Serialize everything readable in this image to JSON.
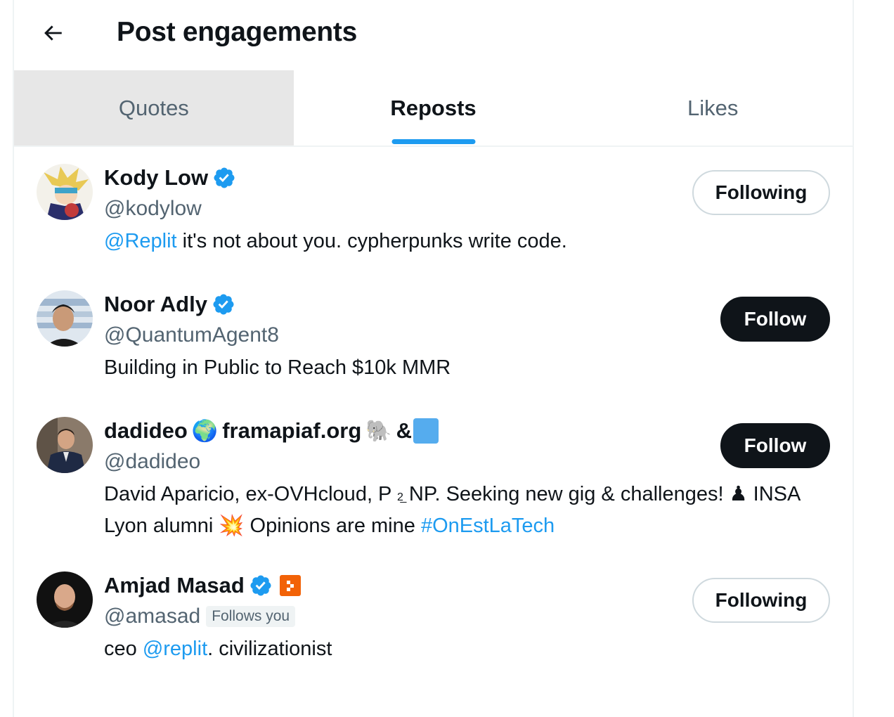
{
  "header": {
    "title": "Post engagements",
    "back_icon": "arrow-left-icon"
  },
  "tabs": [
    {
      "label": "Quotes",
      "state": "hover"
    },
    {
      "label": "Reposts",
      "state": "active"
    },
    {
      "label": "Likes",
      "state": "default"
    }
  ],
  "colors": {
    "accent": "#1d9bf0",
    "text": "#0f1419",
    "muted": "#536471",
    "border": "#cfd9de"
  },
  "users": [
    {
      "name": "Kody Low",
      "verified": true,
      "handle": "@kodylow",
      "bio_mention": "@Replit",
      "bio_text": " it's not about you. cypherpunks write code.",
      "button": "Following"
    },
    {
      "name": "Noor Adly",
      "verified": true,
      "handle": "@QuantumAgent8",
      "bio_text": "Building in Public to Reach $10k MMR",
      "button": "Follow"
    },
    {
      "name_part1": "dadideo",
      "globe_emoji": "🌍",
      "name_part2": "framapiaf.org",
      "elephant_emoji": "🐘",
      "name_part3": "&",
      "handle": "@dadideo",
      "bio_line1": "David Aparicio, ex-OVHcloud, P",
      "bio_small": "2̲",
      "bio_line1b": " NP. Seeking new gig & challenges! ♟ INSA",
      "bio_line2": "Lyon alumni ",
      "bio_boom": "💥",
      "bio_line2b": " Opinions are mine ",
      "bio_hashtag": "#OnEstLaTech",
      "button": "Follow"
    },
    {
      "name": "Amjad Masad",
      "verified": true,
      "affiliate_icon": "replit-badge-icon",
      "handle": "@amasad",
      "follows_you": "Follows you",
      "bio_pre": "ceo ",
      "bio_mention": "@replit",
      "bio_post": ". civilizationist",
      "button": "Following"
    }
  ]
}
